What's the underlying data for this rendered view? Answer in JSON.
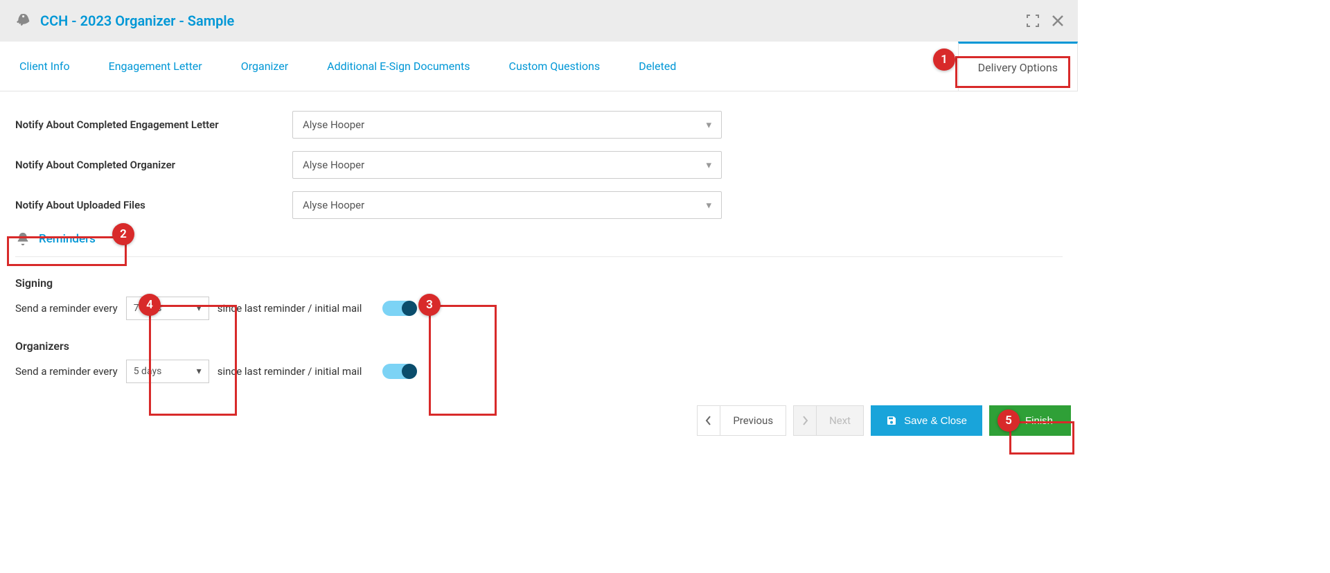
{
  "header": {
    "title": "CCH - 2023 Organizer - Sample"
  },
  "tabs": {
    "client_info": "Client Info",
    "engagement_letter": "Engagement Letter",
    "organizer": "Organizer",
    "additional_esign": "Additional E-Sign Documents",
    "custom_questions": "Custom Questions",
    "deleted": "Deleted",
    "delivery_options": "Delivery Options"
  },
  "fields": {
    "engagement_label": "Notify About Completed Engagement Letter",
    "engagement_value": "Alyse Hooper",
    "organizer_label": "Notify About Completed Organizer",
    "organizer_value": "Alyse Hooper",
    "uploaded_label": "Notify About Uploaded Files",
    "uploaded_value": "Alyse Hooper"
  },
  "reminders": {
    "section_title": "Reminders",
    "signing_heading": "Signing",
    "organizers_heading": "Organizers",
    "prefix": "Send a reminder every",
    "suffix": "since last reminder / initial mail",
    "signing_interval": "7 days",
    "organizers_interval": "5 days"
  },
  "footer": {
    "previous": "Previous",
    "next": "Next",
    "save_close": "Save & Close",
    "finish": "Finish"
  },
  "callouts": {
    "c1": "1",
    "c2": "2",
    "c3": "3",
    "c4": "4",
    "c5": "5"
  }
}
